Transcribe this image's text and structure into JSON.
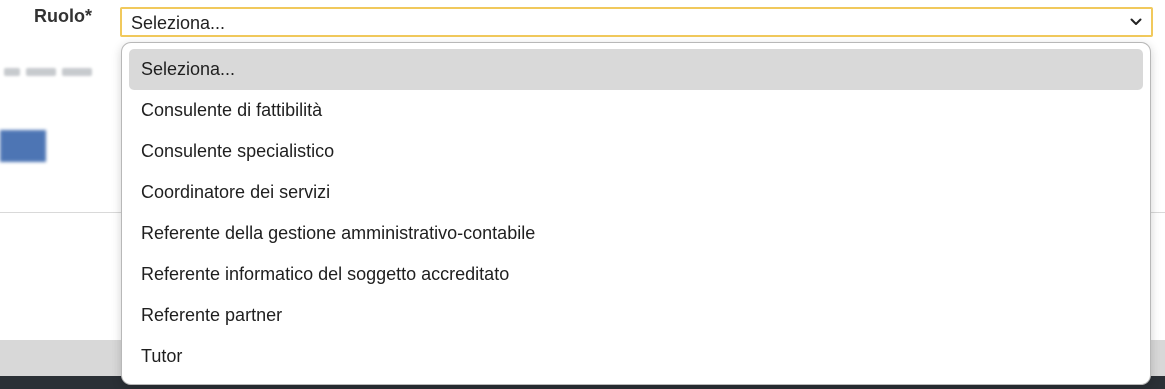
{
  "form": {
    "role_label": "Ruolo*",
    "role_select": {
      "selected": "Seleziona...",
      "options": [
        "Seleziona...",
        "Consulente di fattibilità",
        "Consulente specialistico",
        "Coordinatore dei servizi",
        "Referente della gestione amministrativo-contabile",
        "Referente informatico del soggetto accreditato",
        "Referente partner",
        "Tutor"
      ]
    }
  },
  "colors": {
    "focus_border": "#f1c95c",
    "option_highlight": "#d9d9d9"
  },
  "icons": {
    "caret": "chevron-down-icon"
  }
}
